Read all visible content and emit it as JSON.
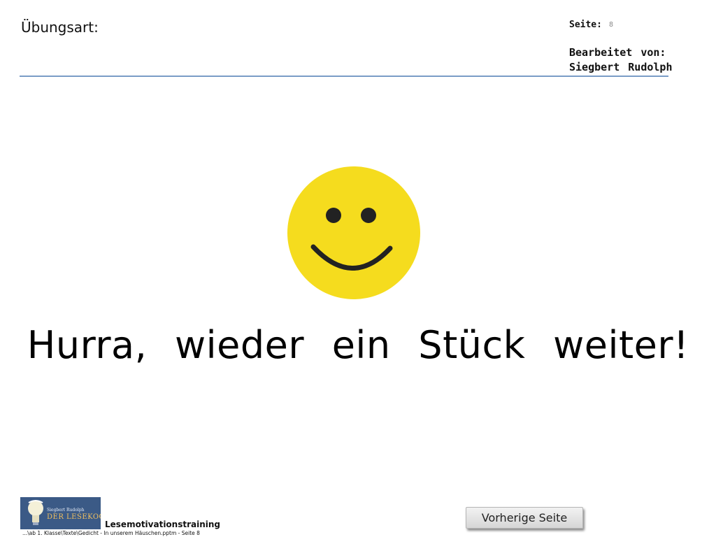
{
  "header": {
    "title": "Übungsart:",
    "page_label": "Seite:",
    "page_number": "8",
    "editor_label": "Bearbeitet von:",
    "editor_name": "Siegbert Rudolph"
  },
  "main": {
    "icon": "smiley-face-icon",
    "message": "Hurra, wieder ein Stück weiter!",
    "colors": {
      "smiley_fill": "#f5dc1e",
      "smiley_features": "#222222",
      "header_rule": "#7a9cc6"
    }
  },
  "footer": {
    "logo": {
      "icon": "lightbulb-icon",
      "small_text": "Siegbert Rudolph",
      "main_text": "DER LESEKOCH"
    },
    "title": "Lesemotivationstraining",
    "path": "...\\ab 1. Klasse\\Texte\\Gedicht - In unserem Häuschen.pptm - Seite 8",
    "prev_button_label": "Vorherige Seite"
  }
}
